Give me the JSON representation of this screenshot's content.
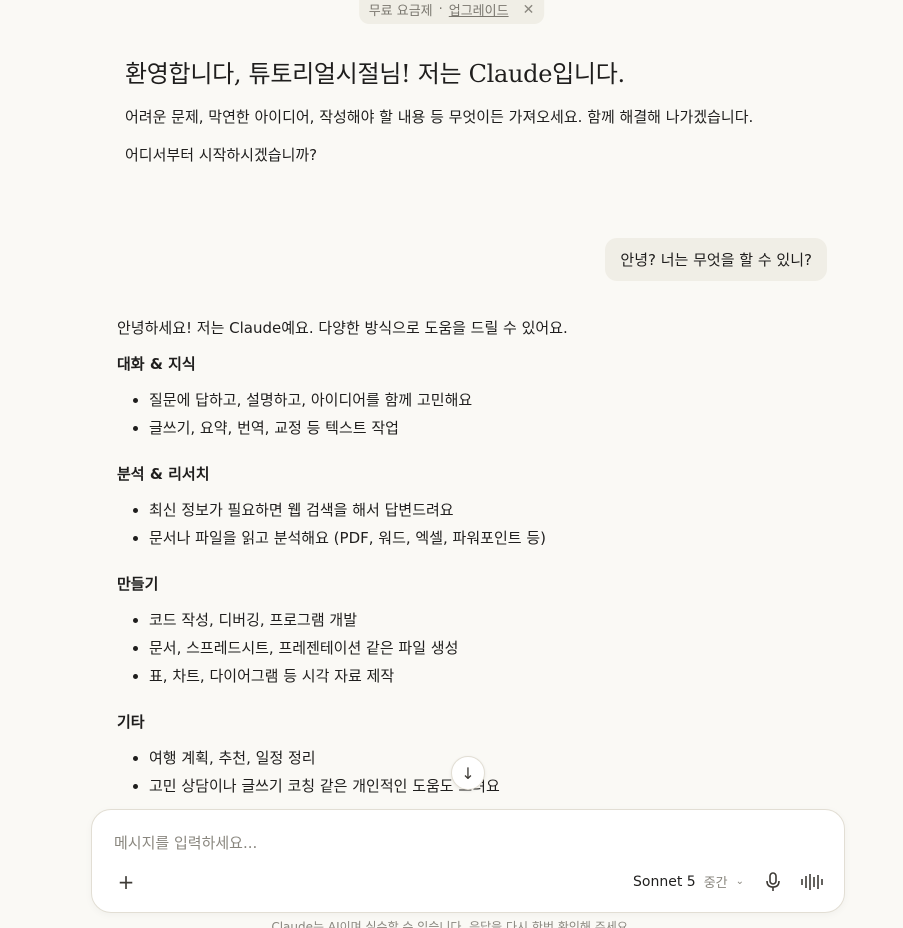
{
  "banner": {
    "plan_label": "무료 요금제",
    "separator": "·",
    "upgrade_label": "업그레이드",
    "close_glyph": "✕"
  },
  "greeting": {
    "title": "환영합니다, 튜토리얼시절님! 저는 Claude입니다.",
    "paragraph1": "어려운 문제, 막연한 아이디어, 작성해야 할 내용 등 무엇이든 가져오세요. 함께 해결해 나가겠습니다.",
    "paragraph2": "어디서부터 시작하시겠습니까?"
  },
  "user_message": "안녕? 너는 무엇을 할 수 있니?",
  "reply": {
    "intro": "안녕하세요! 저는 Claude예요. 다양한 방식으로 도움을 드릴 수 있어요.",
    "sections": [
      {
        "heading": "대화 & 지식",
        "items": [
          "질문에 답하고, 설명하고, 아이디어를 함께 고민해요",
          "글쓰기, 요약, 번역, 교정 등 텍스트 작업"
        ]
      },
      {
        "heading": "분석 & 리서치",
        "items": [
          "최신 정보가 필요하면 웹 검색을 해서 답변드려요",
          "문서나 파일을 읽고 분석해요 (PDF, 워드, 엑셀, 파워포인트 등)"
        ]
      },
      {
        "heading": "만들기",
        "items": [
          "코드 작성, 디버깅, 프로그램 개발",
          "문서, 스프레드시트, 프레젠테이션 같은 파일 생성",
          "표, 차트, 다이어그램 등 시각 자료 제작"
        ]
      },
      {
        "heading": "기타",
        "items": [
          "여행 계획, 추천, 일정 정리",
          "고민 상담이나 글쓰기 코칭 같은 개인적인 도움도 드려요"
        ]
      }
    ]
  },
  "scroll_button": {
    "icon": "arrow-down-icon",
    "glyph": "↓"
  },
  "composer": {
    "placeholder": "메시지를 입력하세요...",
    "value": "",
    "add_glyph": "+",
    "model_name": "Sonnet 5",
    "effort_label": "중간",
    "chevron_glyph": "⌄"
  },
  "disclaimer": "Claude는 AI이며 실수할 수 있습니다. 응답을 다시 한번 확인해 주세요."
}
